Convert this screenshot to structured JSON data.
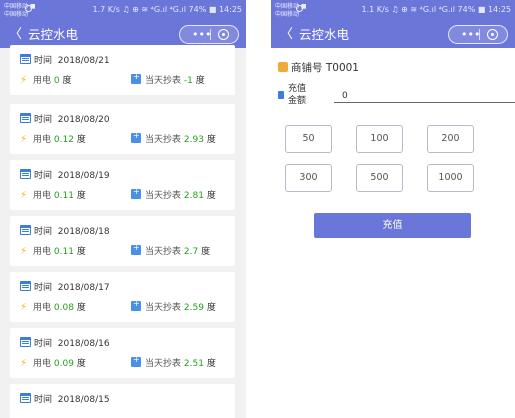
{
  "colors": {
    "primary": "#6b76d9",
    "accent_green": "#23a11b",
    "bolt": "#f4b21a",
    "calendar": "#3a7de0"
  },
  "left": {
    "status": {
      "carrier_line1": "中国移动 ■",
      "carrier_line2": "中国移动",
      "right": "1.7 K/s ♫ ⊕ ≋ ⁴G.ıl ⁴G.ıl 74% ■ 14:25"
    },
    "nav": {
      "back": "〈",
      "title": "云控水电",
      "more": "•••"
    },
    "records": [
      {
        "time_label": "时间",
        "date": "2018/08/21",
        "usage_label": "用电",
        "usage": "0",
        "unit": "度",
        "reading_label": "当天抄表",
        "reading": "-1",
        "reading_unit": "度"
      },
      {
        "time_label": "时间",
        "date": "2018/08/20",
        "usage_label": "用电",
        "usage": "0.12",
        "unit": "度",
        "reading_label": "当天抄表",
        "reading": "2.93",
        "reading_unit": "度"
      },
      {
        "time_label": "时间",
        "date": "2018/08/19",
        "usage_label": "用电",
        "usage": "0.11",
        "unit": "度",
        "reading_label": "当天抄表",
        "reading": "2.81",
        "reading_unit": "度"
      },
      {
        "time_label": "时间",
        "date": "2018/08/18",
        "usage_label": "用电",
        "usage": "0.11",
        "unit": "度",
        "reading_label": "当天抄表",
        "reading": "2.7",
        "reading_unit": "度"
      },
      {
        "time_label": "时间",
        "date": "2018/08/17",
        "usage_label": "用电",
        "usage": "0.08",
        "unit": "度",
        "reading_label": "当天抄表",
        "reading": "2.59",
        "reading_unit": "度"
      },
      {
        "time_label": "时间",
        "date": "2018/08/16",
        "usage_label": "用电",
        "usage": "0.09",
        "unit": "度",
        "reading_label": "当天抄表",
        "reading": "2.51",
        "reading_unit": "度"
      },
      {
        "time_label": "时间",
        "date": "2018/08/15"
      }
    ]
  },
  "right": {
    "status": {
      "carrier_line1": "中国移动 ■",
      "carrier_line2": "中国移动",
      "right": "1.1 K/s ♫ ⊕ ≋ ⁴G.ıl ⁴G.ıl 74% ■ 14:25"
    },
    "nav": {
      "back": "〈",
      "title": "云控水电",
      "more": "•••"
    },
    "shop": {
      "label": "商铺号",
      "value": "T0001"
    },
    "amount": {
      "label_line1": "充值",
      "label_line2": "金额",
      "value": "0"
    },
    "amounts": [
      "50",
      "100",
      "200",
      "300",
      "500",
      "1000"
    ],
    "submit_label": "充值"
  }
}
